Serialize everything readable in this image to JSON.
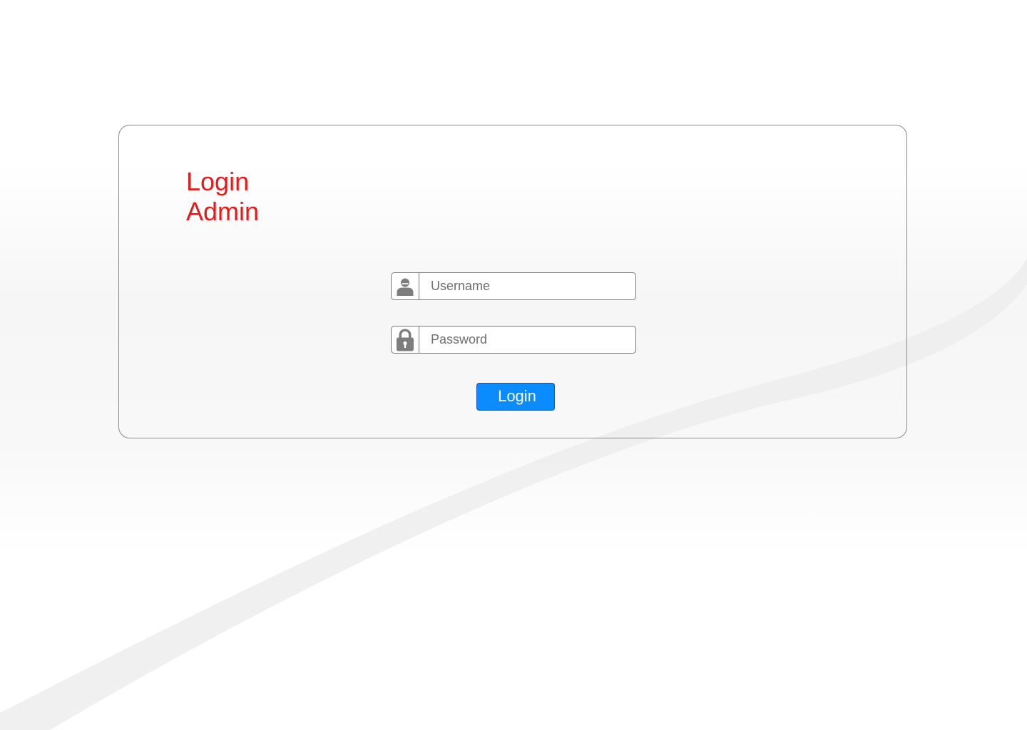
{
  "login_form": {
    "title_line1": "Login",
    "title_line2": "Admin",
    "username_placeholder": "Username",
    "password_placeholder": "Password",
    "submit_label": "Login",
    "username_icon": "user-icon",
    "password_icon": "lock-icon"
  },
  "colors": {
    "title": "#e51a1a",
    "button": "#0a8cff",
    "button_border": "#0a4fd6",
    "border": "#7a7a7a",
    "icon": "#7d7d7d",
    "background_swoosh": "#ededed"
  }
}
